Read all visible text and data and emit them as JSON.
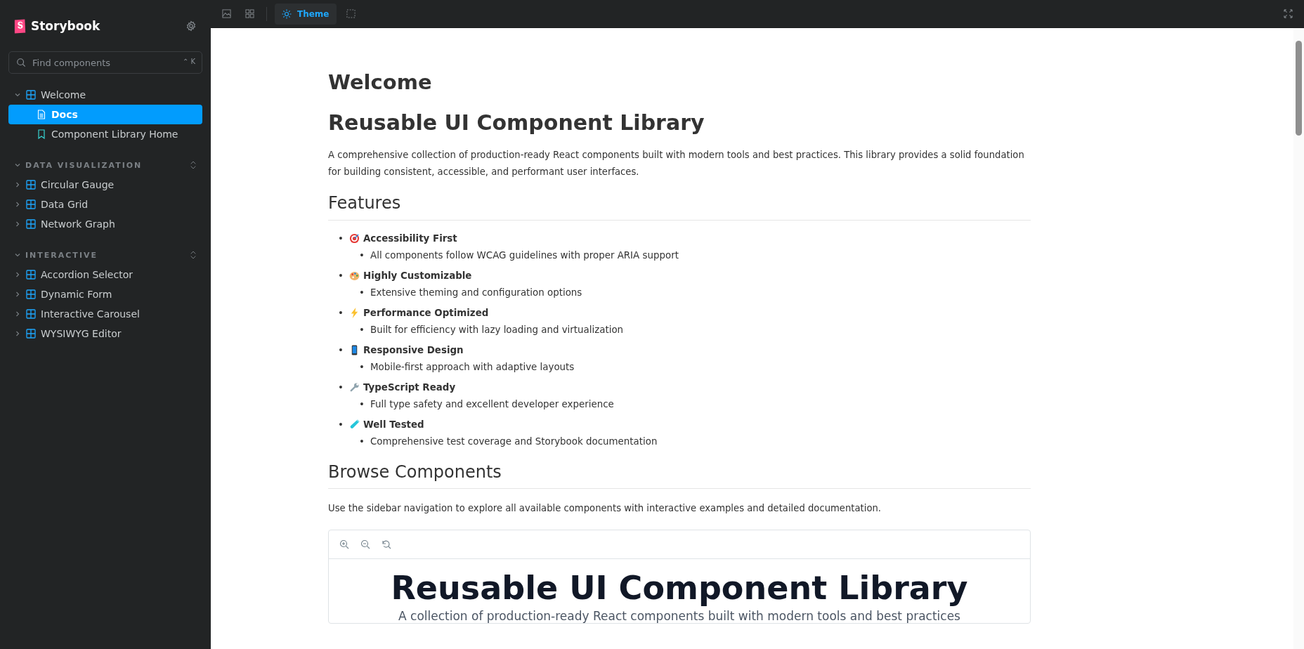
{
  "sidebar": {
    "brand": "Storybook",
    "search": {
      "placeholder": "Find components",
      "shortcut": "⌃ K"
    },
    "groups": [
      {
        "items": [
          {
            "label": "Welcome",
            "kind": "component",
            "expanded": true,
            "selected": false,
            "children": [
              {
                "label": "Docs",
                "kind": "docs",
                "selected": true
              },
              {
                "label": "Component Library Home",
                "kind": "story",
                "selected": false
              }
            ]
          }
        ]
      },
      {
        "label": "DATA VISUALIZATION",
        "items": [
          {
            "label": "Circular Gauge",
            "kind": "component",
            "expanded": false,
            "selected": false
          },
          {
            "label": "Data Grid",
            "kind": "component",
            "expanded": false,
            "selected": false
          },
          {
            "label": "Network Graph",
            "kind": "component",
            "expanded": false,
            "selected": false
          }
        ]
      },
      {
        "label": "INTERACTIVE",
        "items": [
          {
            "label": "Accordion Selector",
            "kind": "component",
            "expanded": false,
            "selected": false
          },
          {
            "label": "Dynamic Form",
            "kind": "component",
            "expanded": false,
            "selected": false
          },
          {
            "label": "Interactive Carousel",
            "kind": "component",
            "expanded": false,
            "selected": false
          },
          {
            "label": "WYSIWYG Editor",
            "kind": "component",
            "expanded": false,
            "selected": false
          }
        ]
      }
    ]
  },
  "toolbar": {
    "theme_button": "Theme"
  },
  "doc": {
    "title": "Welcome",
    "subtitle": "Reusable UI Component Library",
    "intro": "A comprehensive collection of production-ready React components built with modern tools and best practices. This library provides a solid foundation for building consistent, accessible, and performant user interfaces.",
    "features_heading": "Features",
    "features": [
      {
        "marker": "•",
        "title": "Accessibility First",
        "detail_marker": "•",
        "detail": "All components follow WCAG guidelines with proper ARIA support"
      },
      {
        "marker": "•",
        "title": "Highly Customizable",
        "detail_marker": "•",
        "detail": "Extensive theming and configuration options"
      },
      {
        "marker": "•",
        "title": "Performance Optimized",
        "detail_marker": "•",
        "detail": "Built for efficiency with lazy loading and virtualization"
      },
      {
        "marker": "•",
        "title": "Responsive Design",
        "detail_marker": "•",
        "detail": "Mobile-first approach with adaptive layouts"
      },
      {
        "marker": "•",
        "title": "TypeScript Ready",
        "detail_marker": "•",
        "detail": "Full type safety and excellent developer experience"
      },
      {
        "marker": "•",
        "title": "Well Tested",
        "detail_marker": "•",
        "detail": "Comprehensive test coverage and Storybook documentation"
      }
    ],
    "browse_heading": "Browse Components",
    "browse_text": "Use the sidebar navigation to explore all available components with interactive examples and detailed documentation.",
    "preview": {
      "title": "Reusable UI Component Library",
      "subtitle": "A collection of production-ready React components built with modern tools and best practices"
    }
  }
}
